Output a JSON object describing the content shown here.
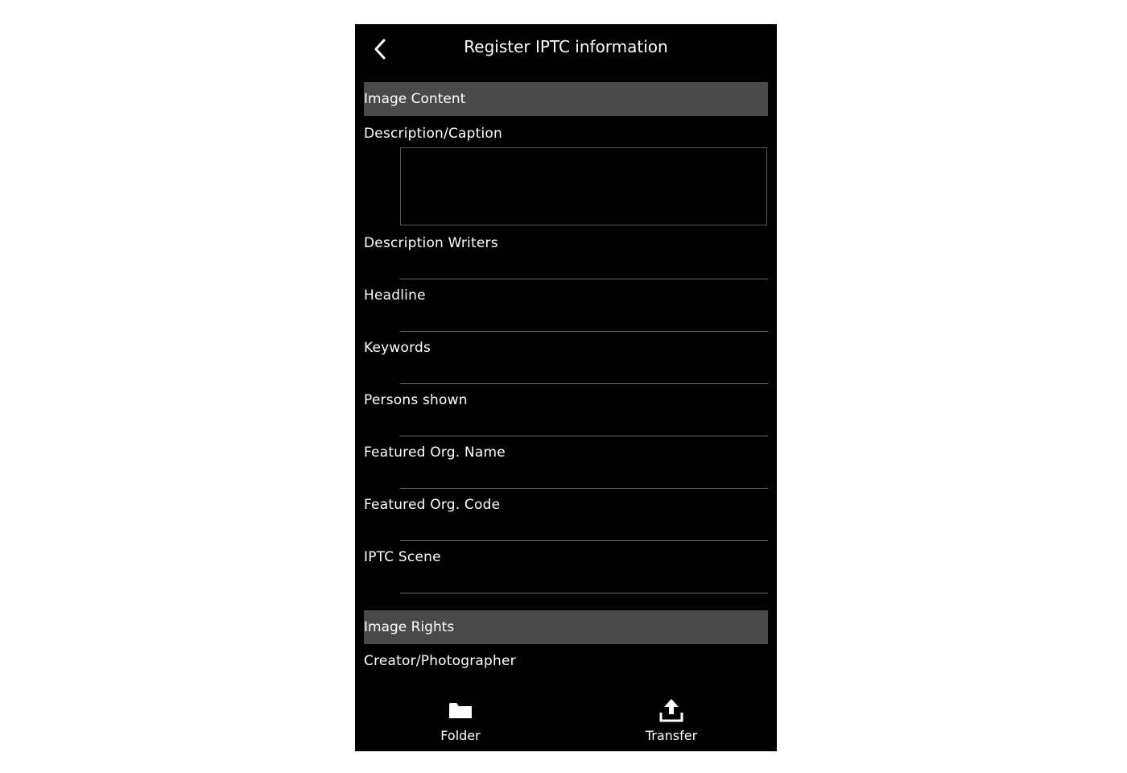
{
  "header": {
    "title": "Register IPTC information",
    "back_icon": "chevron-left-icon"
  },
  "sections": {
    "image_content": {
      "label": "Image Content",
      "fields": {
        "description_caption": {
          "label": "Description/Caption",
          "value": ""
        },
        "description_writers": {
          "label": "Description Writers",
          "value": ""
        },
        "headline": {
          "label": "Headline",
          "value": ""
        },
        "keywords": {
          "label": "Keywords",
          "value": ""
        },
        "persons_shown": {
          "label": "Persons shown",
          "value": ""
        },
        "featured_org_name": {
          "label": "Featured Org. Name",
          "value": ""
        },
        "featured_org_code": {
          "label": "Featured Org. Code",
          "value": ""
        },
        "iptc_scene": {
          "label": "IPTC Scene",
          "value": ""
        }
      }
    },
    "image_rights": {
      "label": "Image Rights",
      "fields": {
        "creator_photographer": {
          "label": "Creator/Photographer"
        }
      }
    }
  },
  "tabbar": {
    "folder": {
      "label": "Folder",
      "icon": "folder-icon"
    },
    "transfer": {
      "label": "Transfer",
      "icon": "upload-icon"
    }
  },
  "colors": {
    "background": "#000000",
    "section_bar": "#4a4a4a",
    "text": "#ffffff",
    "divider": "#6a6a6a"
  }
}
